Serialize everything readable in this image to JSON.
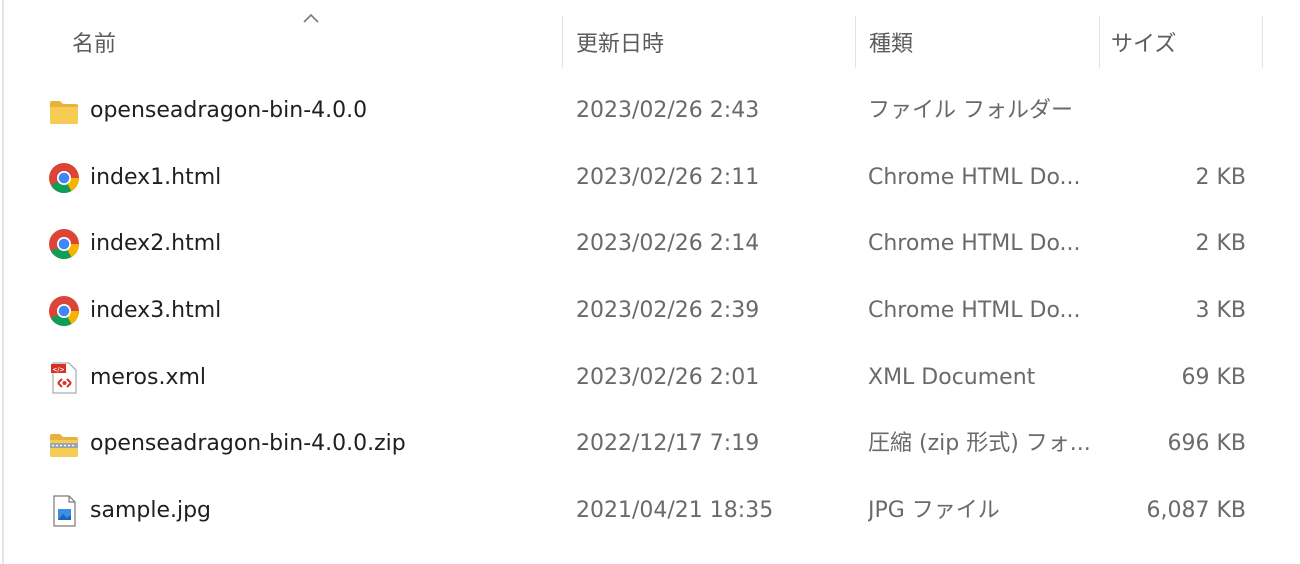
{
  "columns": {
    "name": "名前",
    "date": "更新日時",
    "type": "種類",
    "size": "サイズ",
    "sort": "ascending"
  },
  "files": [
    {
      "name": "openseadragon-bin-4.0.0",
      "date": "2023/02/26 2:43",
      "type": "ファイル フォルダー",
      "size": "",
      "icon": "folder-icon"
    },
    {
      "name": "index1.html",
      "date": "2023/02/26 2:11",
      "type": "Chrome HTML Do...",
      "size": "2 KB",
      "icon": "chrome-icon"
    },
    {
      "name": "index2.html",
      "date": "2023/02/26 2:14",
      "type": "Chrome HTML Do...",
      "size": "2 KB",
      "icon": "chrome-icon"
    },
    {
      "name": "index3.html",
      "date": "2023/02/26 2:39",
      "type": "Chrome HTML Do...",
      "size": "3 KB",
      "icon": "chrome-icon"
    },
    {
      "name": "meros.xml",
      "date": "2023/02/26 2:01",
      "type": "XML Document",
      "size": "69 KB",
      "icon": "xml-file-icon"
    },
    {
      "name": "openseadragon-bin-4.0.0.zip",
      "date": "2022/12/17 7:19",
      "type": "圧縮 (zip 形式) フォ...",
      "size": "696 KB",
      "icon": "zip-folder-icon"
    },
    {
      "name": "sample.jpg",
      "date": "2021/04/21 18:35",
      "type": "JPG ファイル",
      "size": "6,087 KB",
      "icon": "image-file-icon"
    }
  ],
  "colors": {
    "folder": "#f4c84a",
    "chrome_red": "#db4437",
    "chrome_green": "#0f9d58",
    "chrome_yellow": "#f4b400",
    "chrome_blue": "#4285f4",
    "xml_red": "#d93025"
  }
}
